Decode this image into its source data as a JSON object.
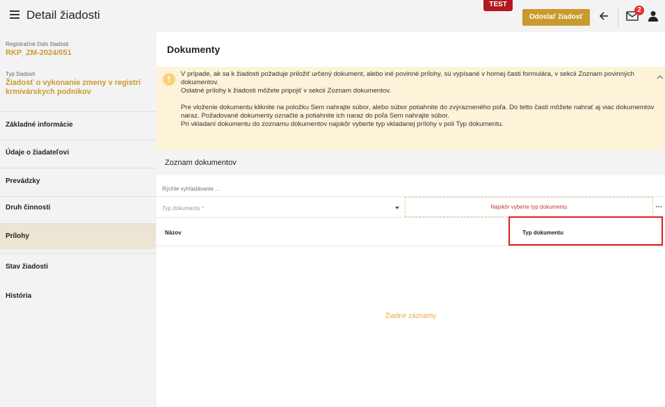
{
  "header": {
    "title": "Detail žiadosti",
    "test_badge": "TEST",
    "send_button": "Odoslať žiadosť",
    "notification_count": "2"
  },
  "sidebar": {
    "reg_label": "Registračné číslo žiadosti",
    "reg_value": "RKP_ZM-2024/051",
    "type_label": "Typ žiadosti",
    "type_value": "Žiadosť o vykonanie zmeny v registri krmivárskych podnikov",
    "items": [
      {
        "label": "Základné informácie",
        "active": false
      },
      {
        "label": "Údaje o žiadateľovi",
        "active": false
      },
      {
        "label": "Prevádzky",
        "active": false
      },
      {
        "label": "Druh činnosti",
        "active": false
      },
      {
        "label": "Prílohy",
        "active": true
      },
      {
        "label": "Stav žiadosti",
        "active": false
      },
      {
        "label": "História",
        "active": false
      }
    ]
  },
  "main": {
    "title": "Dokumenty",
    "info": {
      "paragraph1_line1": "V prípade, ak sa k žiadosti požaduje priložiť určený dokument, alebo iné povinné prílohy, sú vypísané v hornej časti formulára, v sekcii Zoznam povinných dokumentov.",
      "paragraph1_line2": "Ostatné prílohy k žiadosti môžete pripojiť v sekcii Zoznam dokumentov.",
      "paragraph2_line1": "Pre vloženie dokumentu kliknite na položku Sem nahrajte súbor, alebo súbor potiahnite do zvýrazneného poľa. Do tetto časti môžete nahrať aj viac dokumemtov naraz. Požadované dokumenty označte a potiahnite ich naraz do poľa Sem nahrajte súbor.",
      "paragraph2_line2": "Pri vkladaní dokumentu do zoznamu dokumentov najskôr vyberte typ vkladanej prílohy v poli Typ dokumentu."
    },
    "section_title": "Zoznam dokumentov",
    "search_placeholder": "Rýchle vyhľadávanie ...",
    "doc_type_placeholder": "Typ dokumentu *",
    "upload_hint": "Najskôr vyberte typ dokumentu",
    "more": "⋯",
    "columns": {
      "name": "Názov",
      "type": "Typ dokumentu"
    },
    "empty_text": "Žiadne záznamy"
  },
  "colors": {
    "accent": "#c99a2e",
    "highlight": "#e21b1b",
    "info_bg": "#fdf3d9"
  }
}
